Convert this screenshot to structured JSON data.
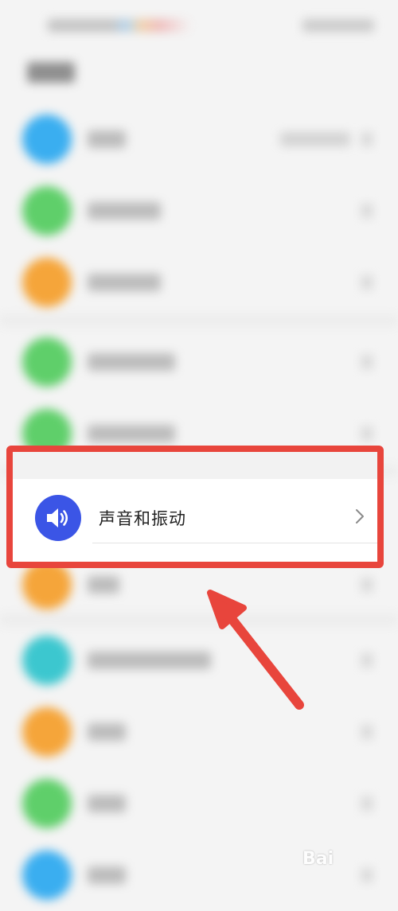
{
  "highlighted_item": {
    "label": "声音和振动",
    "icon": "speaker-icon",
    "icon_color": "#3b55e6"
  },
  "annotation": {
    "box_color": "#e8453c",
    "arrow_color": "#e8453c"
  },
  "blurred_rows": [
    {
      "icon_color": "#3aaef0",
      "label_width": 48,
      "has_value": true
    },
    {
      "icon_color": "#5fcf6a",
      "label_width": 92,
      "has_value": false
    },
    {
      "icon_color": "#f5a53a",
      "label_width": 92,
      "has_value": false
    },
    {
      "icon_color": "#5fcf6a",
      "label_width": 110,
      "has_value": false
    },
    {
      "icon_color": "#5fcf6a",
      "label_width": 110,
      "has_value": false
    },
    {
      "icon_color": "#f5a53a",
      "label_width": 40,
      "has_value": false
    },
    {
      "icon_color": "#3cc7cf",
      "label_width": 155,
      "has_value": false
    },
    {
      "icon_color": "#f5a53a",
      "label_width": 48,
      "has_value": false
    },
    {
      "icon_color": "#5fcf6a",
      "label_width": 48,
      "has_value": false
    },
    {
      "icon_color": "#3aaef0",
      "label_width": 48,
      "has_value": false
    }
  ]
}
